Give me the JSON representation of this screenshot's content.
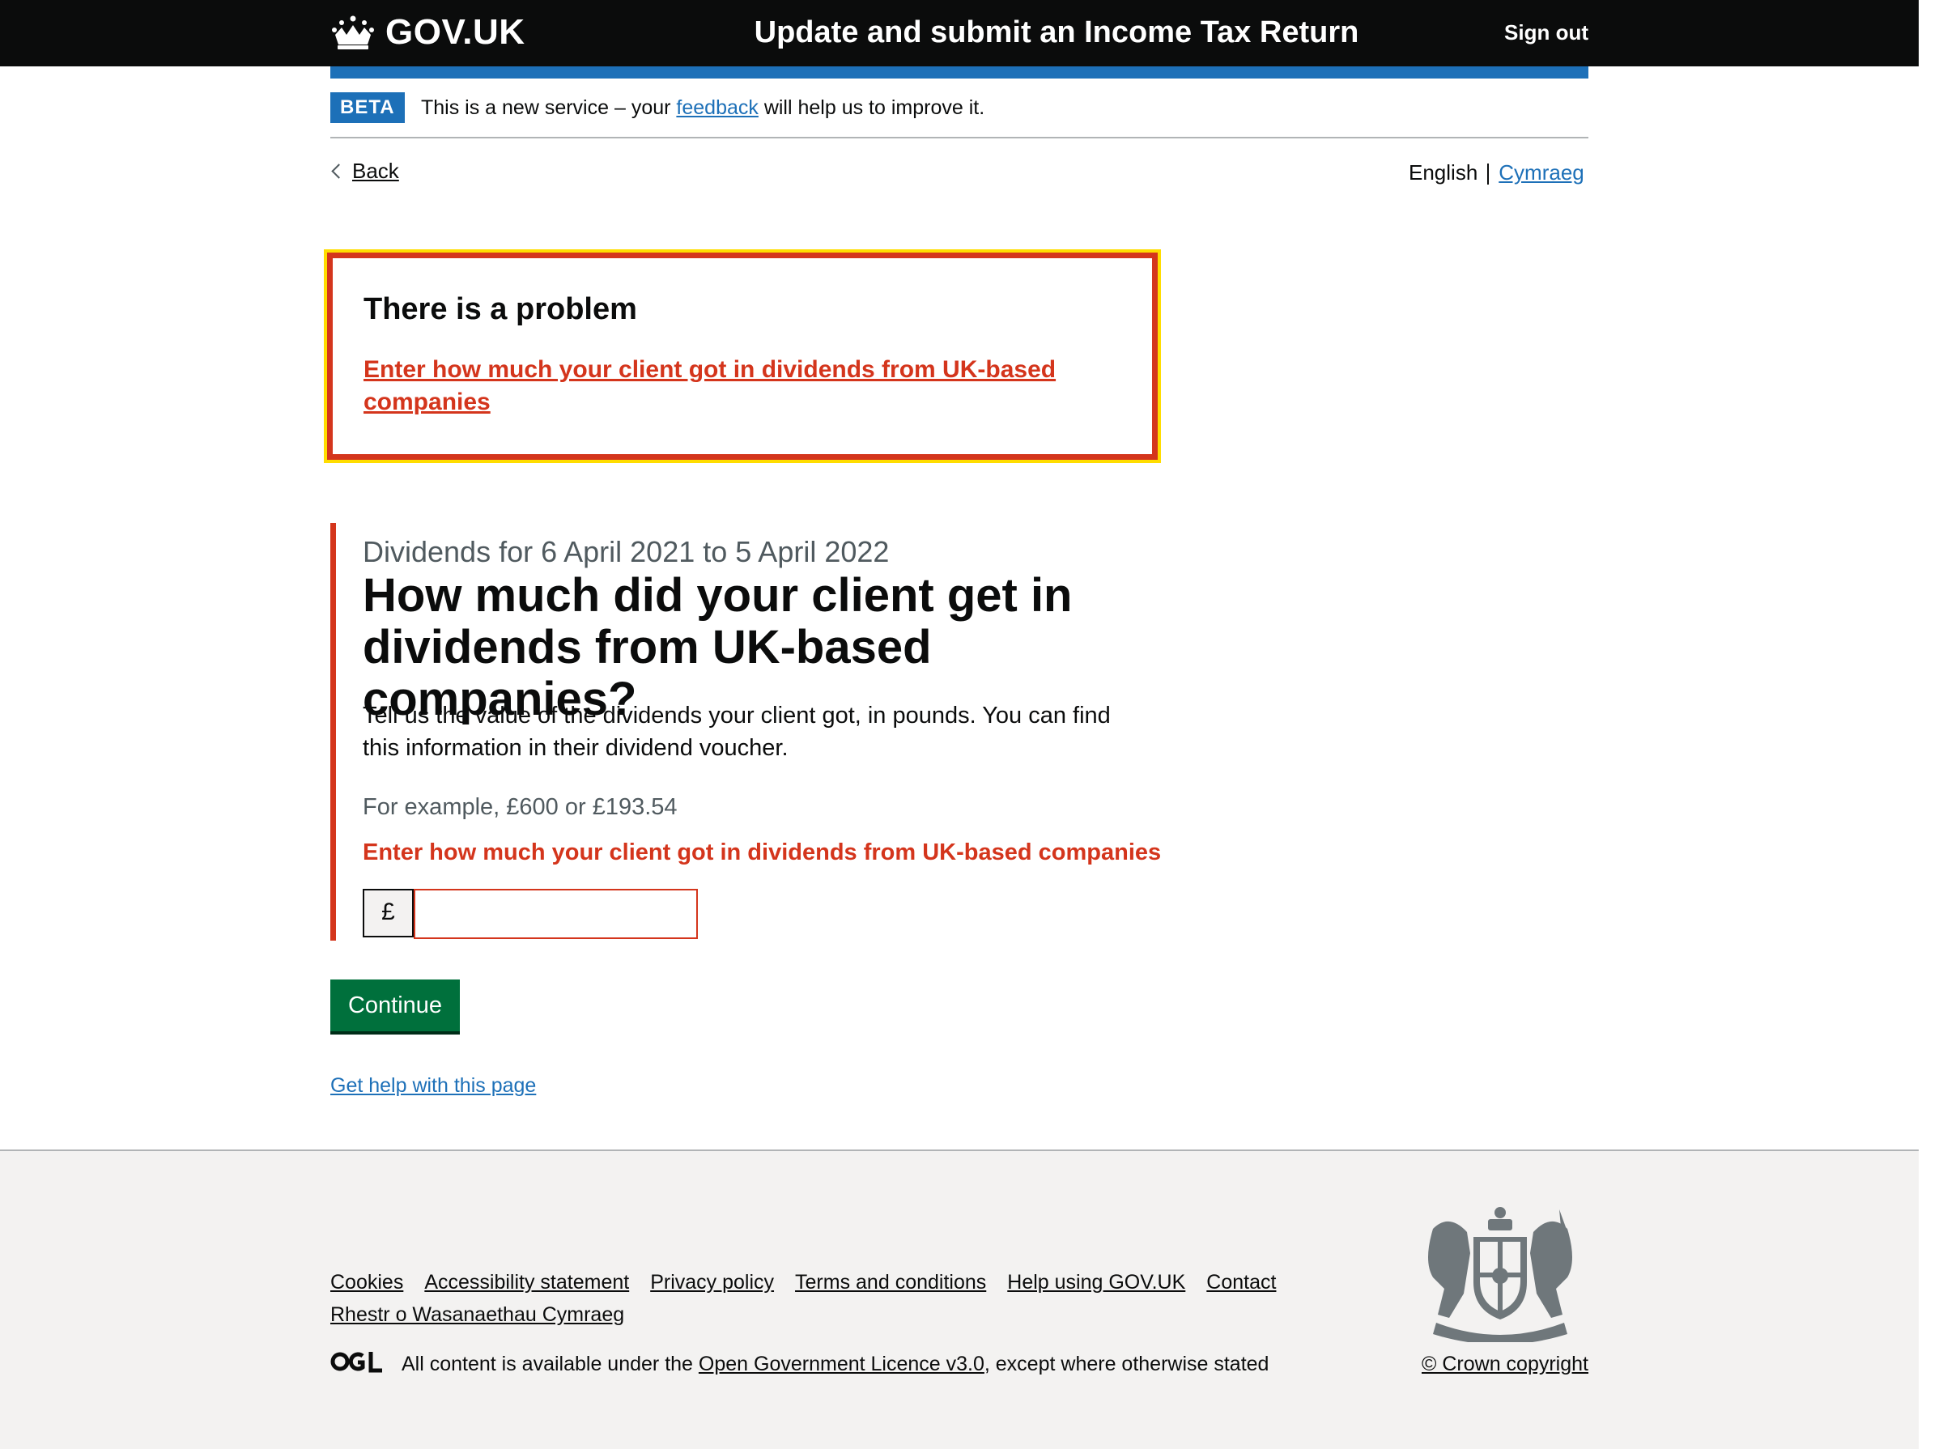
{
  "header": {
    "logo_text": "GOV.UK",
    "service_name": "Update and submit an Income Tax Return",
    "sign_out": "Sign out"
  },
  "phase_banner": {
    "tag": "BETA",
    "text_before": "This is a new service – your ",
    "link": "feedback",
    "text_after": " will help us to improve it."
  },
  "nav": {
    "back": "Back",
    "lang_current": "English",
    "lang_other": "Cymraeg"
  },
  "error_summary": {
    "title": "There is a problem",
    "error_link": "Enter how much your client got in dividends from UK-based companies"
  },
  "form": {
    "caption": "Dividends for 6 April 2021 to 5 April 2022",
    "question": "How much did your client get in dividends from UK-based companies?",
    "body": "Tell us the value of the dividends your client got, in pounds. You can find this information in their dividend voucher.",
    "hint": "For example, £600 or £193.54",
    "error_message": "Enter how much your client got in dividends from UK-based companies",
    "prefix": "£",
    "input_value": ""
  },
  "actions": {
    "continue": "Continue",
    "help": "Get help with this page"
  },
  "footer": {
    "links": [
      "Cookies",
      "Accessibility statement",
      "Privacy policy",
      "Terms and conditions",
      "Help using GOV.UK",
      "Contact",
      "Rhestr o Wasanaethau Cymraeg"
    ],
    "licence_before": "All content is available under the ",
    "licence_link": "Open Government Licence v3.0",
    "licence_after": ", except where otherwise stated",
    "copyright": "© Crown copyright"
  },
  "colors": {
    "header_bg": "#0b0c0c",
    "brand_blue": "#1d70b8",
    "error_red": "#d4351c",
    "focus_yellow": "#ffdd00",
    "button_green": "#00703c",
    "footer_bg": "#f3f2f1"
  },
  "icons": [
    "crown-icon",
    "back-chevron-icon",
    "ogl-logo-icon",
    "royal-coat-of-arms-icon"
  ]
}
